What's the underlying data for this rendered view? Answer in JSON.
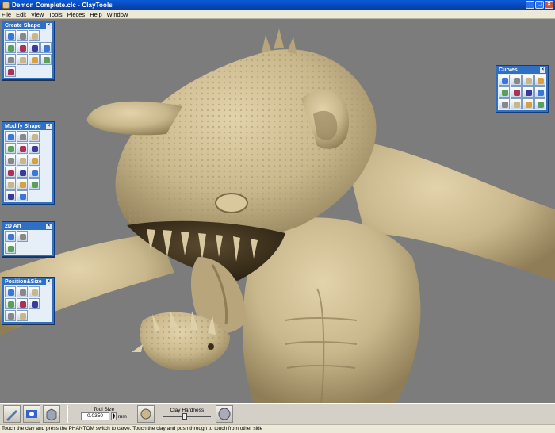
{
  "window": {
    "title": "Demon Complete.clc - ClayTools"
  },
  "menu": [
    "File",
    "Edit",
    "View",
    "Tools",
    "Pieces",
    "Help",
    "Window"
  ],
  "palettes": {
    "create_shape": {
      "title": "Create Shape",
      "rows": 4,
      "cols": 4,
      "tools": [
        "box-icon",
        "rounded-box-icon",
        "flat-box-icon",
        "",
        "column-icon",
        "cylinder-icon",
        "oval-icon",
        "sphere-icon",
        "cup-icon",
        "cone-icon",
        "wedge-icon",
        "ball-icon",
        "import-icon",
        "",
        "",
        ""
      ]
    },
    "modify_shape": {
      "title": "Modify Shape",
      "rows": 6,
      "cols": 4,
      "tools": [
        "carve-icon",
        "smooth-icon",
        "pull-icon",
        "",
        "stamp-icon",
        "flatten-icon",
        "pinch-icon",
        "",
        "globe-icon",
        "lathe-icon",
        "emboss-icon",
        "",
        "twist-icon",
        "brush-icon",
        "smudge-icon",
        "",
        "bend-icon",
        "texture-icon",
        "swirl-icon",
        "",
        "scale-icon",
        "grid-icon",
        "",
        ""
      ]
    },
    "art_2d": {
      "title": "2D Art",
      "rows": 2,
      "cols": 4,
      "tools": [
        "sketch-icon",
        "line-icon",
        "",
        "",
        "image-icon",
        "",
        "",
        ""
      ]
    },
    "position_size": {
      "title": "Position&Size",
      "rows": 3,
      "cols": 4,
      "tools": [
        "move-icon",
        "rotate-icon",
        "cone-icon",
        "",
        "lock-icon",
        "rotate-view-icon",
        "orbit-icon",
        "",
        "tilt-icon",
        "zoom-icon",
        "",
        ""
      ]
    },
    "curves": {
      "title": "Curves",
      "rows": 3,
      "cols": 4,
      "tools": [
        "curve-icon",
        "sweep-icon",
        "tube-icon",
        "ring-icon",
        "scissors-icon",
        "bevel-icon",
        "pin-icon",
        "spiral-icon",
        "arrow-icon",
        "trash-icon",
        "shield-icon",
        "globe-icon"
      ]
    }
  },
  "toolbar": {
    "tool_size_label": "Tool Size",
    "tool_size_value": "0.0350",
    "unit": "mm",
    "hardness_label": "Clay Hardness",
    "hardness_level": 0.45
  },
  "status": "Touch the clay and press the PHANTOM switch to carve. Touch the clay and push through to touch from other side",
  "colors": {
    "clay": "#c9b78c",
    "viewport_bg": "#7c7c7c",
    "palette_blue": "#2f6fc4",
    "titlebar": "#0846b8"
  }
}
